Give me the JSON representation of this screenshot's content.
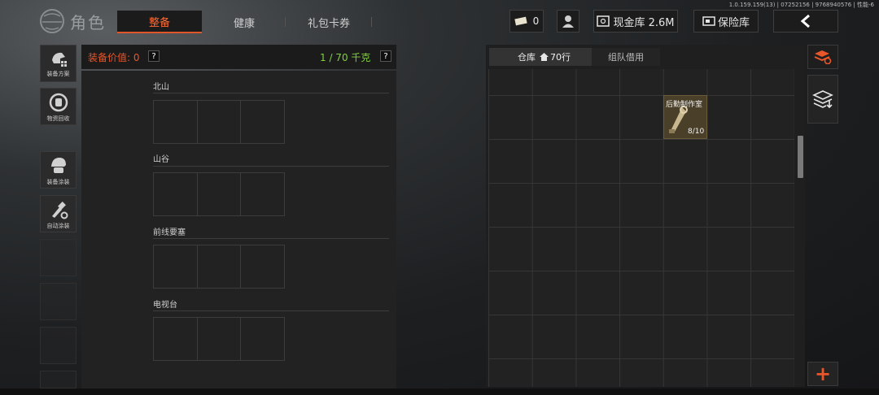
{
  "version": "1.0.159.159(13) | 07252156 | 9768940576 | 性能-6",
  "header": {
    "title": "角色",
    "tabs": [
      {
        "label": "整备",
        "active": true
      },
      {
        "label": "健康",
        "active": false
      },
      {
        "label": "礼包卡券",
        "active": false
      }
    ],
    "ticket_count": "0",
    "cash_label": "现金库 2.6M",
    "vault_label": "保险库",
    "accent_color": "#e0552a"
  },
  "sidebar": {
    "items": [
      {
        "label": "装备方案",
        "icon": "loadout-icon"
      },
      {
        "label": "物资回收",
        "icon": "recycle-icon"
      },
      {
        "label": "装备涂装",
        "icon": "paint-helmet-icon"
      },
      {
        "label": "自动涂装",
        "icon": "auto-paint-icon"
      }
    ]
  },
  "equipment": {
    "value_label": "装备价值: 0",
    "capacity_label": "1 / 70 千克",
    "help": "?",
    "sections": [
      {
        "name": "北山"
      },
      {
        "name": "山谷"
      },
      {
        "name": "前线要塞"
      },
      {
        "name": "电视台"
      }
    ]
  },
  "warehouse": {
    "tab_label": "仓库",
    "rows_label": "70行",
    "borrow_tab": "组队借用",
    "item": {
      "name": "后勤制作室",
      "count": "8/10",
      "icon": "key-icon"
    }
  },
  "rightbar": {
    "add": "+"
  }
}
